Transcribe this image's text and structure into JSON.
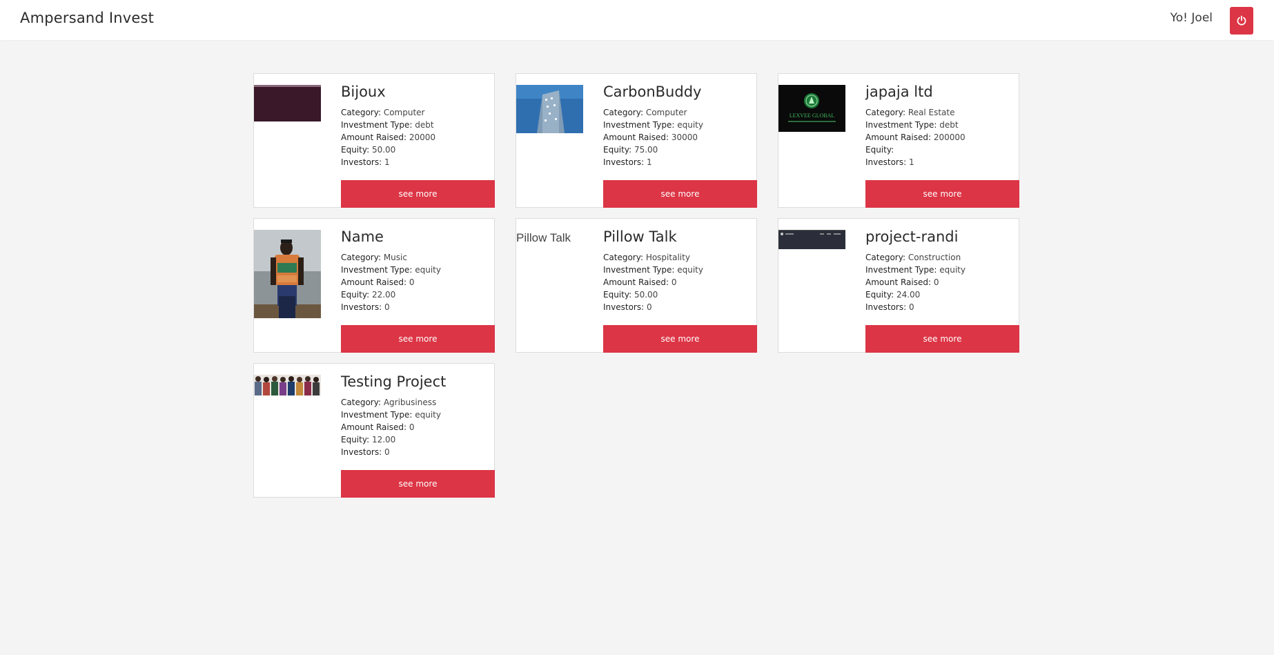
{
  "header": {
    "brand": "Ampersand Invest",
    "greeting": "Yo! Joel",
    "logout_icon": "power-icon"
  },
  "colors": {
    "accent": "#dc3545",
    "page_bg": "#f4f4f4",
    "card_bg": "#ffffff"
  },
  "labels": {
    "category": "Category:",
    "investment_type": "Investment Type:",
    "amount_raised": "Amount Raised:",
    "equity": "Equity:",
    "investors": "Investors:",
    "see_more": "see more"
  },
  "projects": [
    {
      "name": "Bijoux",
      "category": "Computer",
      "investment_type": "debt",
      "amount_raised": "20000",
      "equity": "50.00",
      "investors": "1"
    },
    {
      "name": "CarbonBuddy",
      "category": "Computer",
      "investment_type": "equity",
      "amount_raised": "30000",
      "equity": "75.00",
      "investors": "1"
    },
    {
      "name": "japaja ltd",
      "category": "Real Estate",
      "investment_type": "debt",
      "amount_raised": "200000",
      "equity": "",
      "investors": "1",
      "logo_text": "LEXVEE GLOBAL"
    },
    {
      "name": "Name",
      "category": "Music",
      "investment_type": "equity",
      "amount_raised": "0",
      "equity": "22.00",
      "investors": "0"
    },
    {
      "name": "Pillow Talk",
      "category": "Hospitality",
      "investment_type": "equity",
      "amount_raised": "0",
      "equity": "50.00",
      "investors": "0",
      "image_alt": "Pillow Talk"
    },
    {
      "name": "project-randi",
      "category": "Construction",
      "investment_type": "equity",
      "amount_raised": "0",
      "equity": "24.00",
      "investors": "0"
    },
    {
      "name": "Testing Project",
      "category": "Agribusiness",
      "investment_type": "equity",
      "amount_raised": "0",
      "equity": "12.00",
      "investors": "0"
    }
  ]
}
